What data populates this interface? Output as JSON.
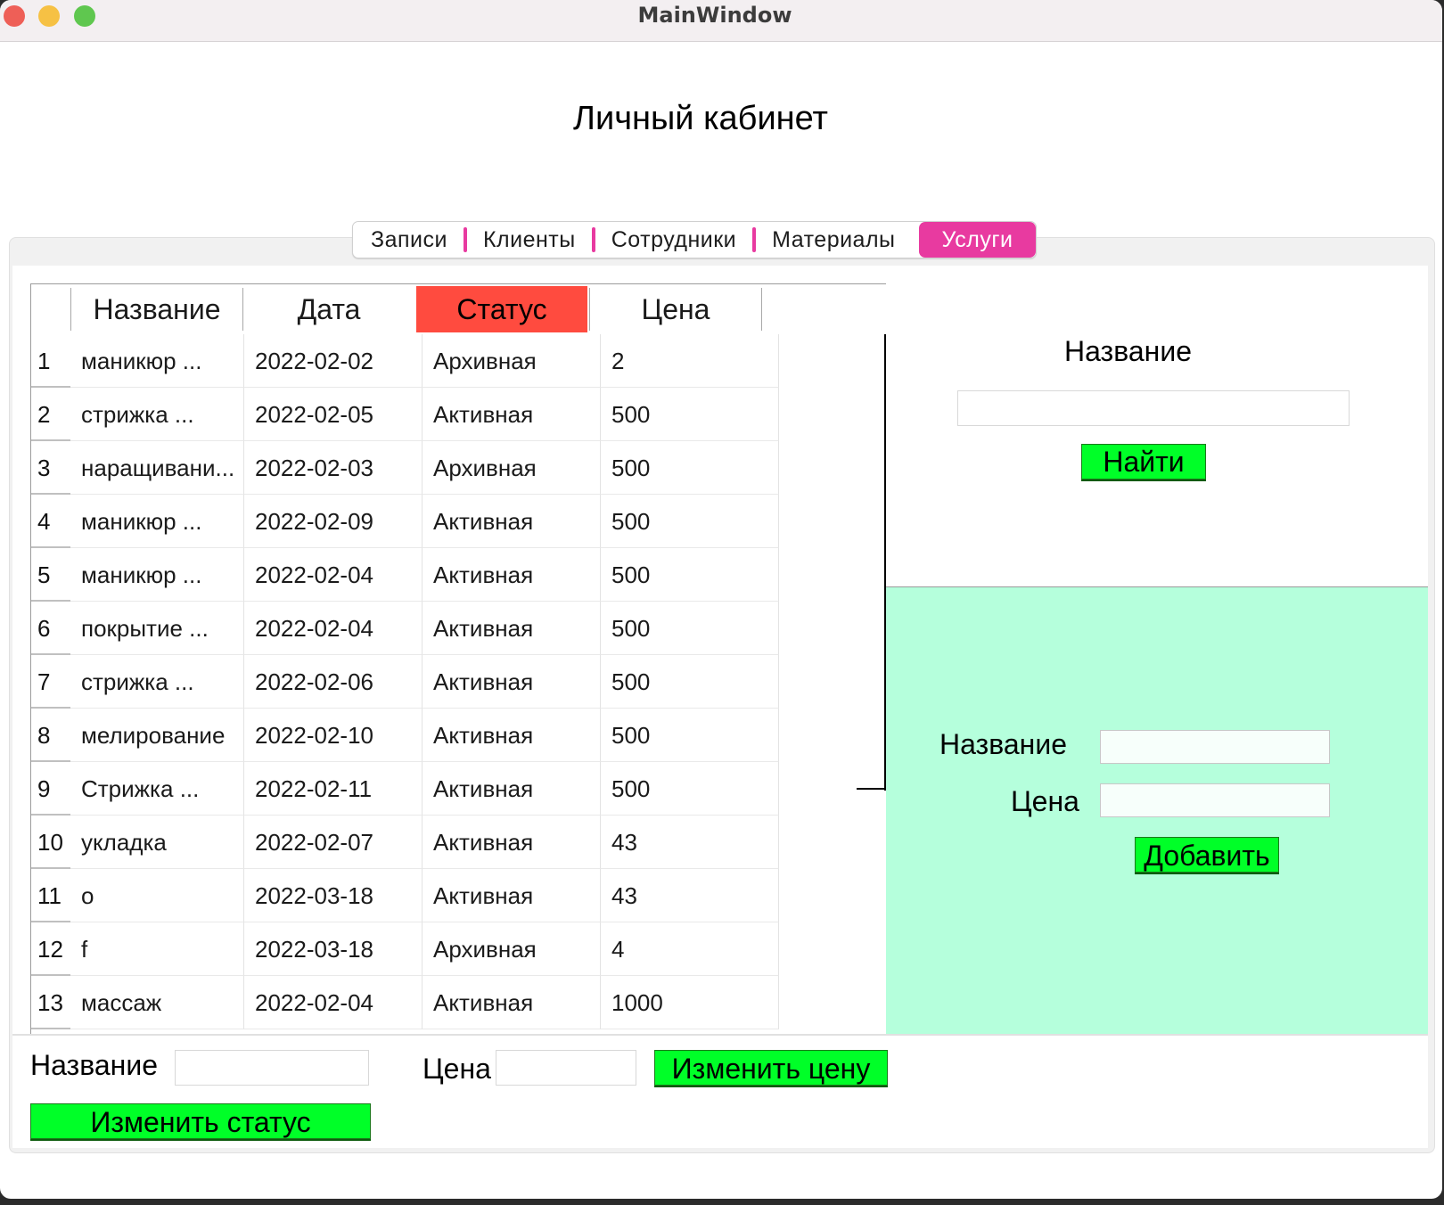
{
  "window": {
    "title": "MainWindow"
  },
  "page": {
    "title": "Личный кабинет"
  },
  "tabs": [
    {
      "label": "Записи",
      "active": false
    },
    {
      "label": "Клиенты",
      "active": false
    },
    {
      "label": "Сотрудники",
      "active": false
    },
    {
      "label": "Материалы",
      "active": false
    },
    {
      "label": "Услуги",
      "active": true
    }
  ],
  "table": {
    "headers": [
      "Название",
      "Дата",
      "Статус",
      "Цена"
    ],
    "rows": [
      {
        "num": "1",
        "name": "маникюр ...",
        "date": "2022-02-02",
        "status": "Архивная",
        "price": "2"
      },
      {
        "num": "2",
        "name": "стрижка ...",
        "date": "2022-02-05",
        "status": "Активная",
        "price": "500"
      },
      {
        "num": "3",
        "name": "наращивани...",
        "date": "2022-02-03",
        "status": "Архивная",
        "price": "500"
      },
      {
        "num": "4",
        "name": "маникюр ...",
        "date": "2022-02-09",
        "status": "Активная",
        "price": "500"
      },
      {
        "num": "5",
        "name": "маникюр ...",
        "date": "2022-02-04",
        "status": "Активная",
        "price": "500"
      },
      {
        "num": "6",
        "name": "покрытие ...",
        "date": "2022-02-04",
        "status": "Активная",
        "price": "500"
      },
      {
        "num": "7",
        "name": "стрижка ...",
        "date": "2022-02-06",
        "status": "Активная",
        "price": "500"
      },
      {
        "num": "8",
        "name": "мелирование",
        "date": "2022-02-10",
        "status": "Активная",
        "price": "500"
      },
      {
        "num": "9",
        "name": "Стрижка ...",
        "date": "2022-02-11",
        "status": "Активная",
        "price": "500"
      },
      {
        "num": "10",
        "name": "укладка",
        "date": "2022-02-07",
        "status": "Активная",
        "price": "43"
      },
      {
        "num": "11",
        "name": "о",
        "date": "2022-03-18",
        "status": "Активная",
        "price": "43"
      },
      {
        "num": "12",
        "name": "f",
        "date": "2022-03-18",
        "status": "Архивная",
        "price": "4"
      },
      {
        "num": "13",
        "name": "массаж",
        "date": "2022-02-04",
        "status": "Активная",
        "price": "1000"
      }
    ]
  },
  "search": {
    "label": "Название",
    "value": "",
    "button": "Найти"
  },
  "add": {
    "name_label": "Название",
    "name_value": "",
    "price_label": "Цена",
    "price_value": "",
    "button": "Добавить"
  },
  "edit": {
    "name_label": "Название",
    "name_value": "",
    "price_label": "Цена",
    "price_value": "",
    "change_price_button": "Изменить цену",
    "change_status_button": "Изменить статус"
  },
  "colors": {
    "accent": "#e83aa0",
    "status_header": "#ff4b3f",
    "button": "#00ff28",
    "add_panel": "#b5ffdc"
  }
}
